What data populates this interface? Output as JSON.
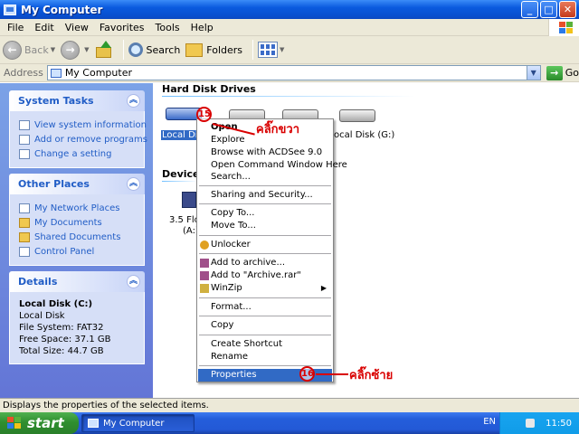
{
  "window": {
    "title": "My Computer"
  },
  "menubar": [
    "File",
    "Edit",
    "View",
    "Favorites",
    "Tools",
    "Help"
  ],
  "toolbar": {
    "back_label": "Back",
    "search_label": "Search",
    "folders_label": "Folders"
  },
  "address": {
    "label": "Address",
    "value": "My Computer",
    "go_label": "Go"
  },
  "left_pane": {
    "system_tasks": {
      "title": "System Tasks",
      "items": [
        "View system information",
        "Add or remove programs",
        "Change a setting"
      ]
    },
    "other_places": {
      "title": "Other Places",
      "items": [
        "My Network Places",
        "My Documents",
        "Shared Documents",
        "Control Panel"
      ]
    },
    "details": {
      "title": "Details",
      "name": "Local Disk (C:)",
      "type": "Local Disk",
      "filesystem": "File System: FAT32",
      "free": "Free Space: 37.1 GB",
      "total": "Total Size: 44.7 GB"
    }
  },
  "main": {
    "hard_disk_heading": "Hard Disk Drives",
    "devices_heading": "Devices",
    "drive_c_label": "Local Disk",
    "drive_g_label": "ocal Disk (G:)",
    "floppy_label_1": "3.5 Flop",
    "floppy_label_2": "(A:)"
  },
  "context_menu": [
    "Open",
    "Explore",
    "Browse with ACDSee 9.0",
    "Open Command Window Here",
    "Search...",
    "Sharing and Security...",
    "Copy To...",
    "Move To...",
    "Unlocker",
    "Add to archive...",
    "Add to \"Archive.rar\"",
    "WinZip",
    "Format...",
    "Copy",
    "Create Shortcut",
    "Rename",
    "Properties"
  ],
  "annotations": {
    "step1_number": "15",
    "step1_text": "คลิ๊กขวา",
    "step2_number": "16",
    "step2_text": "คลิ๊กซ้าย"
  },
  "statusbar": {
    "text": "Displays the properties of the selected items."
  },
  "taskbar": {
    "start_label": "start",
    "task_item": "My Computer",
    "language": "EN",
    "clock": "11:50"
  }
}
